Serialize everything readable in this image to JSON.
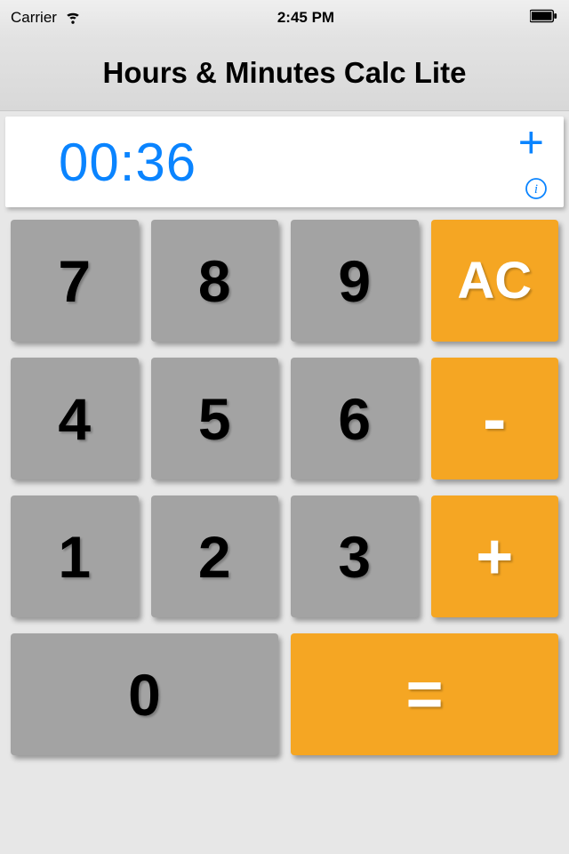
{
  "status": {
    "carrier": "Carrier",
    "time": "2:45 PM"
  },
  "header": {
    "title": "Hours & Minutes Calc Lite"
  },
  "display": {
    "value": "00:36",
    "operation": "+"
  },
  "keypad": {
    "rows": [
      [
        {
          "label": "7",
          "type": "num",
          "name": "digit-7"
        },
        {
          "label": "8",
          "type": "num",
          "name": "digit-8"
        },
        {
          "label": "9",
          "type": "num",
          "name": "digit-9"
        },
        {
          "label": "AC",
          "type": "op",
          "name": "all-clear",
          "variant": "ac"
        }
      ],
      [
        {
          "label": "4",
          "type": "num",
          "name": "digit-4"
        },
        {
          "label": "5",
          "type": "num",
          "name": "digit-5"
        },
        {
          "label": "6",
          "type": "num",
          "name": "digit-6"
        },
        {
          "label": "-",
          "type": "op",
          "name": "subtract",
          "variant": "minus"
        }
      ],
      [
        {
          "label": "1",
          "type": "num",
          "name": "digit-1"
        },
        {
          "label": "2",
          "type": "num",
          "name": "digit-2"
        },
        {
          "label": "3",
          "type": "num",
          "name": "digit-3"
        },
        {
          "label": "+",
          "type": "op",
          "name": "add",
          "variant": "plus"
        }
      ],
      [
        {
          "label": "0",
          "type": "num",
          "name": "digit-0",
          "wide": "zero"
        },
        {
          "label": "=",
          "type": "op",
          "name": "equals",
          "variant": "eq",
          "wide": "equals-wide"
        }
      ]
    ]
  }
}
